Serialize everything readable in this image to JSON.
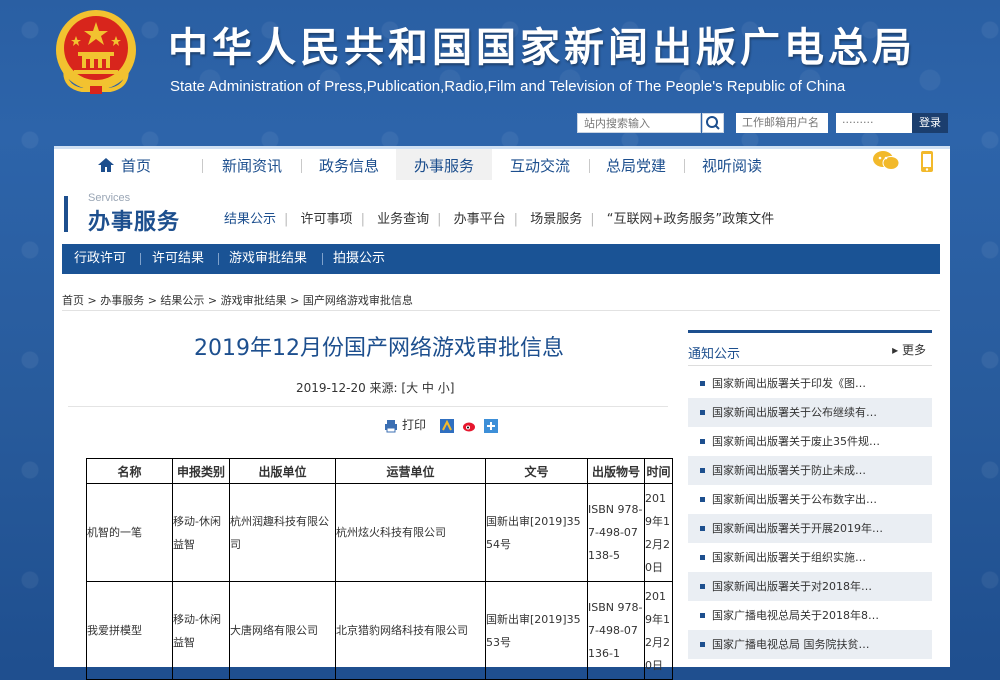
{
  "header": {
    "title_cn": "中华人民共和国国家新闻出版广电总局",
    "title_en": "State Administration of Press,Publication,Radio,Film and Television of The People's Republic of China",
    "search_placeholder": "站内搜索输入",
    "user_placeholder": "工作邮箱用户名",
    "password_mask": "·········",
    "login_label": "登录"
  },
  "nav": {
    "items": [
      {
        "label": "首页"
      },
      {
        "label": "新闻资讯"
      },
      {
        "label": "政务信息"
      },
      {
        "label": "办事服务"
      },
      {
        "label": "互动交流"
      },
      {
        "label": "总局党建"
      },
      {
        "label": "视听阅读"
      }
    ]
  },
  "services": {
    "title_en": "Services",
    "title_cn": "办事服务",
    "sub_nav": [
      "结果公示",
      "许可事项",
      "业务查询",
      "办事平台",
      "场景服务",
      "“互联网+政务服务”政策文件"
    ],
    "blue_bar": [
      "行政许可",
      "许可结果",
      "游戏审批结果",
      "拍摄公示"
    ]
  },
  "breadcrumb": "首页 > 办事服务 > 结果公示 > 游戏审批结果 > 国产网络游戏审批信息",
  "article": {
    "title": "2019年12月份国产网络游戏审批信息",
    "meta": "2019-12-20   来源:     [大 中 小]",
    "print_label": "打印"
  },
  "table": {
    "headers": [
      "名称",
      "申报类别",
      "出版单位",
      "运营单位",
      "文号",
      "出版物号",
      "时间"
    ],
    "rows": [
      [
        "机智的一笔",
        "移动-休闲益智",
        "杭州润趣科技有限公司",
        "杭州炫火科技有限公司",
        "国新出审[2019]3554号",
        "ISBN 978-7-498-07138-5",
        "2019年12月20日"
      ],
      [
        "我爱拼模型",
        "移动-休闲益智",
        "大唐网络有限公司",
        "北京猎豹网络科技有限公司",
        "国新出审[2019]3553号",
        "ISBN 978-7-498-07136-1",
        "2019年12月20日"
      ]
    ]
  },
  "sidebar": {
    "title": "通知公示",
    "more": "▸ 更多",
    "items": [
      "国家新闻出版署关于印发《图…",
      "国家新闻出版署关于公布继续有…",
      "国家新闻出版署关于废止35件规…",
      "国家新闻出版署关于防止未成…",
      "国家新闻出版署关于公布数字出…",
      "国家新闻出版署关于开展2019年…",
      "国家新闻出版署关于组织实施…",
      "国家新闻出版署关于对2018年…",
      "国家广播电视总局关于2018年8…",
      "国家广播电视总局 国务院扶贫…"
    ]
  },
  "colors": {
    "brand_blue": "#1d4f8e",
    "bar_blue": "#1a5395",
    "emblem_red": "#d8251c",
    "emblem_gold": "#f2c230"
  }
}
